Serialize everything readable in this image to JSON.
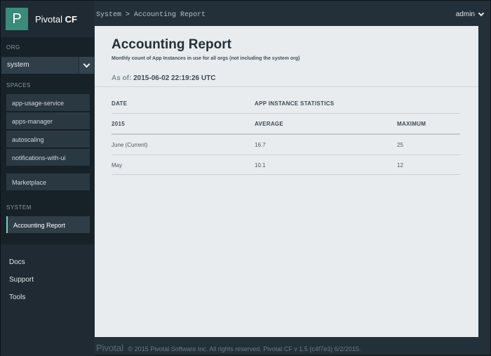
{
  "brand": {
    "logo_letter": "P",
    "name_light": "Pivotal ",
    "name_bold": "CF"
  },
  "topbar": {
    "breadcrumb": "System > Accounting Report",
    "user": "admin"
  },
  "sidebar": {
    "org_label": "ORG",
    "org_value": "system",
    "spaces_label": "SPACES",
    "spaces": [
      "app-usage-service",
      "apps-manager",
      "autoscaling",
      "notifications-with-ui"
    ],
    "marketplace": "Marketplace",
    "system_label": "SYSTEM",
    "system_items": [
      "Accounting Report"
    ],
    "footer_links": [
      "Docs",
      "Support",
      "Tools"
    ]
  },
  "report": {
    "title": "Accounting Report",
    "subtitle": "Monthly count of App Instances in use for all orgs (not including the system org)",
    "asof_label": "As of:",
    "asof_value": "2015-06-02 22:19:26 UTC",
    "headers": {
      "date": "DATE",
      "stats": "APP INSTANCE STATISTICS",
      "year": "2015",
      "average": "AVERAGE",
      "maximum": "MAXIMUM"
    },
    "rows": [
      {
        "month": "June (Current)",
        "average": "16.7",
        "maximum": "25"
      },
      {
        "month": "May",
        "average": "10.1",
        "maximum": "12"
      }
    ]
  },
  "footer": {
    "brand": "Pivotal",
    "text": "© 2015 Pivotal Software Inc. All rights reserved. Pivotal CF v 1.5 (c4f7e3) 6/2/2015."
  },
  "colors": {
    "accent": "#3b8a7a",
    "active_indicator": "#6fd3c3",
    "panel_bg": "#e9ecee",
    "sidebar_bg": "#1f2a32"
  }
}
